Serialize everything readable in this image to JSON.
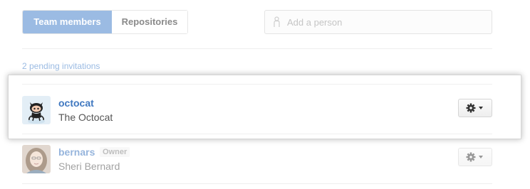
{
  "tabs": [
    {
      "label": "Team members",
      "active": true
    },
    {
      "label": "Repositories",
      "active": false
    }
  ],
  "search": {
    "placeholder": "Add a person"
  },
  "pending_label": "2 pending invitations",
  "members": [
    {
      "login": "octocat",
      "name": "The Octocat",
      "badge": ""
    },
    {
      "login": "bernars",
      "name": "Sheri Bernard",
      "badge": "Owner"
    }
  ],
  "colors": {
    "accent": "#9bbbe3",
    "link": "#4078c0"
  }
}
